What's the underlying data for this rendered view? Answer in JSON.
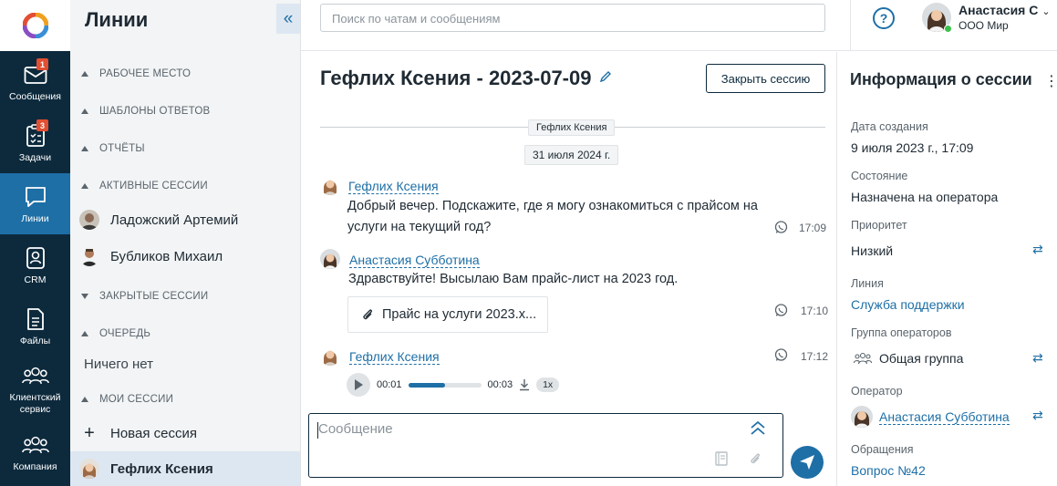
{
  "rail": {
    "items": [
      {
        "label": "Сообщения",
        "badge": "1"
      },
      {
        "label": "Задачи",
        "badge": "3"
      },
      {
        "label": "Линии"
      },
      {
        "label": "CRM"
      },
      {
        "label": "Файлы"
      },
      {
        "label": "Клиентский сервис"
      },
      {
        "label": "Компания"
      }
    ]
  },
  "lines_panel": {
    "title": "Линии",
    "collapse_icon": "«",
    "sections": {
      "workplace": "РАБОЧЕЕ МЕСТО",
      "templates": "ШАБЛОНЫ ОТВЕТОВ",
      "reports": "ОТЧЁТЫ",
      "active": "АКТИВНЫЕ СЕССИИ",
      "closed": "ЗАКРЫТЫЕ СЕССИИ",
      "queue": "ОЧЕРЕДЬ",
      "mine": "МОИ СЕССИИ"
    },
    "active_sessions": [
      "Ладожский Артемий",
      "Бубликов Михаил"
    ],
    "queue_empty": "Ничего нет",
    "new_session": "Новая сессия",
    "my_session": "Гефлих Ксения"
  },
  "topbar": {
    "search_placeholder": "Поиск по чатам и сообщениям",
    "help_icon": "?",
    "user_name": "Анастасия С",
    "user_company": "ООО Мир"
  },
  "chat": {
    "title": "Гефлих Ксения - 2023-07-09",
    "close_button": "Закрыть сессию",
    "source_chip": "Гефлих Ксения",
    "date_chip": "31 июля 2024 г.",
    "messages": [
      {
        "author": "Гефлих Ксения",
        "text_line1": "Добрый вечер. Подскажите, где я могу ознакомиться с прайсом на",
        "text_line2": "услуги на текущий год?",
        "time": "17:09"
      },
      {
        "author": "Анастасия Субботина",
        "text": "Здравствуйте! Высылаю Вам прайс-лист на 2023 год.",
        "attachment": "Прайс на услуги 2023.x...",
        "time": "17:10"
      },
      {
        "author": "Гефлих Ксения",
        "time": "17:12",
        "audio": {
          "current": "00:01",
          "duration": "00:03",
          "speed": "1x",
          "progress": 0.5
        }
      }
    ],
    "composer_placeholder": "Сообщение"
  },
  "info": {
    "title": "Информация о сессии",
    "created_label": "Дата создания",
    "created_value": "9 июля 2023 г., 17:09",
    "state_label": "Состояние",
    "state_value": "Назначена на оператора",
    "priority_label": "Приоритет",
    "priority_value": "Низкий",
    "line_label": "Линия",
    "line_value": "Служба поддержки",
    "group_label": "Группа операторов",
    "group_value": "Общая группа",
    "operator_label": "Оператор",
    "operator_value": "Анастасия Субботина",
    "requests_label": "Обращения",
    "requests_value": "Вопрос №42"
  },
  "colors": {
    "rail": "#0d2a3d",
    "accent": "#1e6fa6",
    "badge": "#e24f32"
  }
}
